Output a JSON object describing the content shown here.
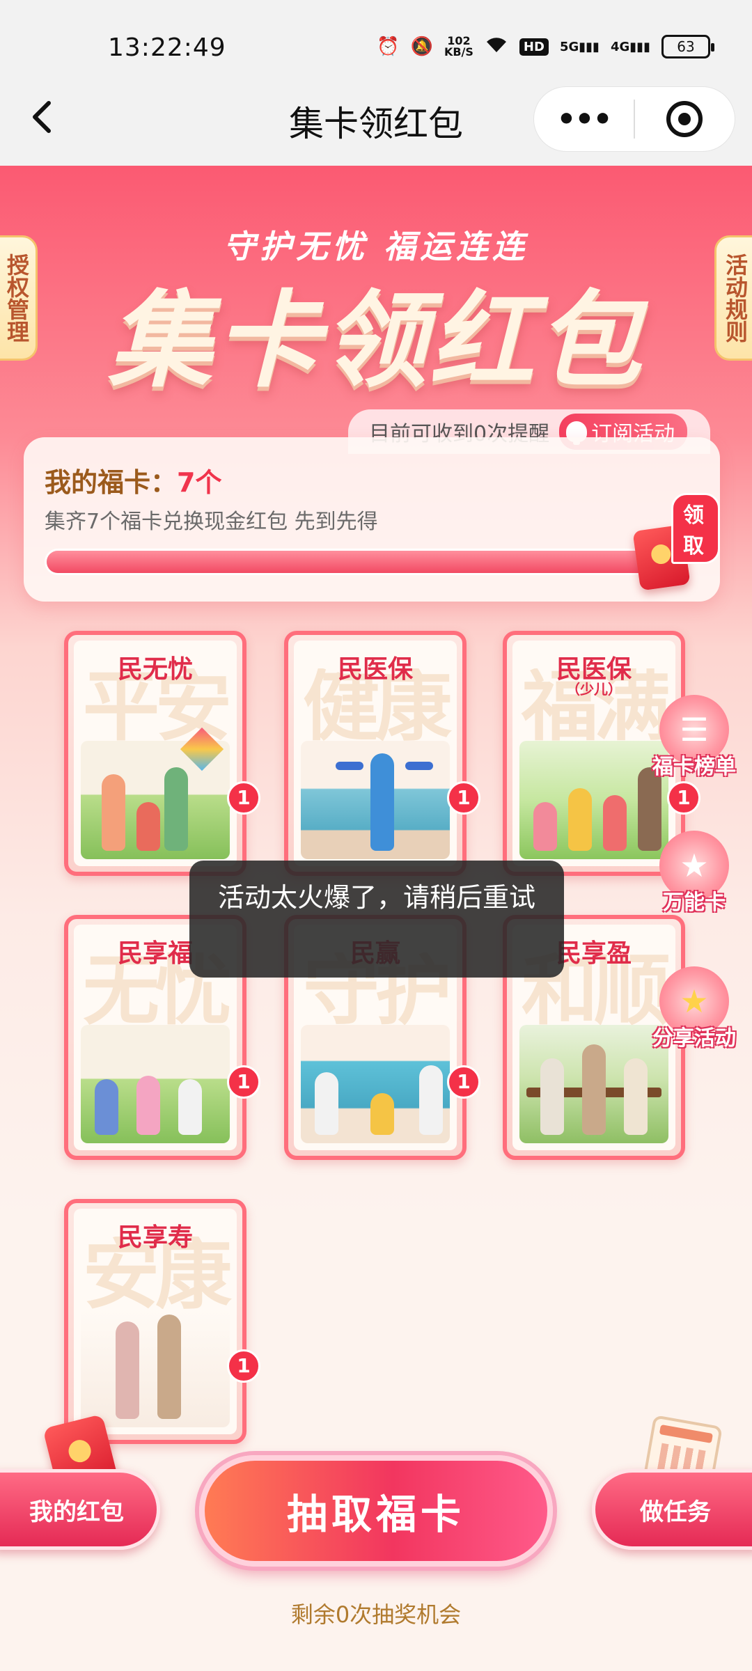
{
  "status": {
    "time": "13:22:49",
    "net_speed_value": "102",
    "net_speed_unit": "KB/S",
    "hd_label": "HD",
    "signal1": "5G",
    "signal2": "4G",
    "battery": "63"
  },
  "nav": {
    "title": "集卡领红包",
    "more_label": "•••"
  },
  "hero": {
    "slogan": "守护无忧 福运连连",
    "title": "集卡领红包",
    "left_tab": "授权管理",
    "right_tab": "活动规则"
  },
  "reminder": {
    "text": "目前可收到0次提醒",
    "subscribe_label": "订阅活动"
  },
  "progress": {
    "title_label": "我的福卡：",
    "count": "7个",
    "description": "集齐7个福卡兑换现金红包 先到先得",
    "claim_label": "领取",
    "fraction": 1.0
  },
  "cards": [
    {
      "name": "民无忧",
      "sub": "",
      "bg_text": "平安",
      "badge": "1"
    },
    {
      "name": "民医保",
      "sub": "",
      "bg_text": "健康",
      "badge": "1"
    },
    {
      "name": "民医保",
      "sub": "（少儿）",
      "bg_text": "福满",
      "badge": "1"
    },
    {
      "name": "民享福",
      "sub": "",
      "bg_text": "无忧",
      "badge": "1"
    },
    {
      "name": "民赢",
      "sub": "",
      "bg_text": "守护",
      "badge": "1"
    },
    {
      "name": "民享盈",
      "sub": "",
      "bg_text": "和顺",
      "badge": ""
    },
    {
      "name": "民享寿",
      "sub": "",
      "bg_text": "安康",
      "badge": "1"
    }
  ],
  "float_tools": [
    {
      "label": "福卡榜单",
      "icon": "ranking-list-icon"
    },
    {
      "label": "万能卡",
      "icon": "wildcard-icon"
    },
    {
      "label": "分享活动",
      "icon": "share-star-icon"
    }
  ],
  "toast": {
    "text": "活动太火爆了，请稍后重试"
  },
  "bottom": {
    "my_redpacket": "我的红包",
    "draw_button": "抽取福卡",
    "tasks": "做任务",
    "remaining": "剩余0次抽奖机会"
  },
  "colors": {
    "accent": "#f43148",
    "gold_text": "#9b5a1c",
    "remaining_text": "#b07a2e"
  }
}
